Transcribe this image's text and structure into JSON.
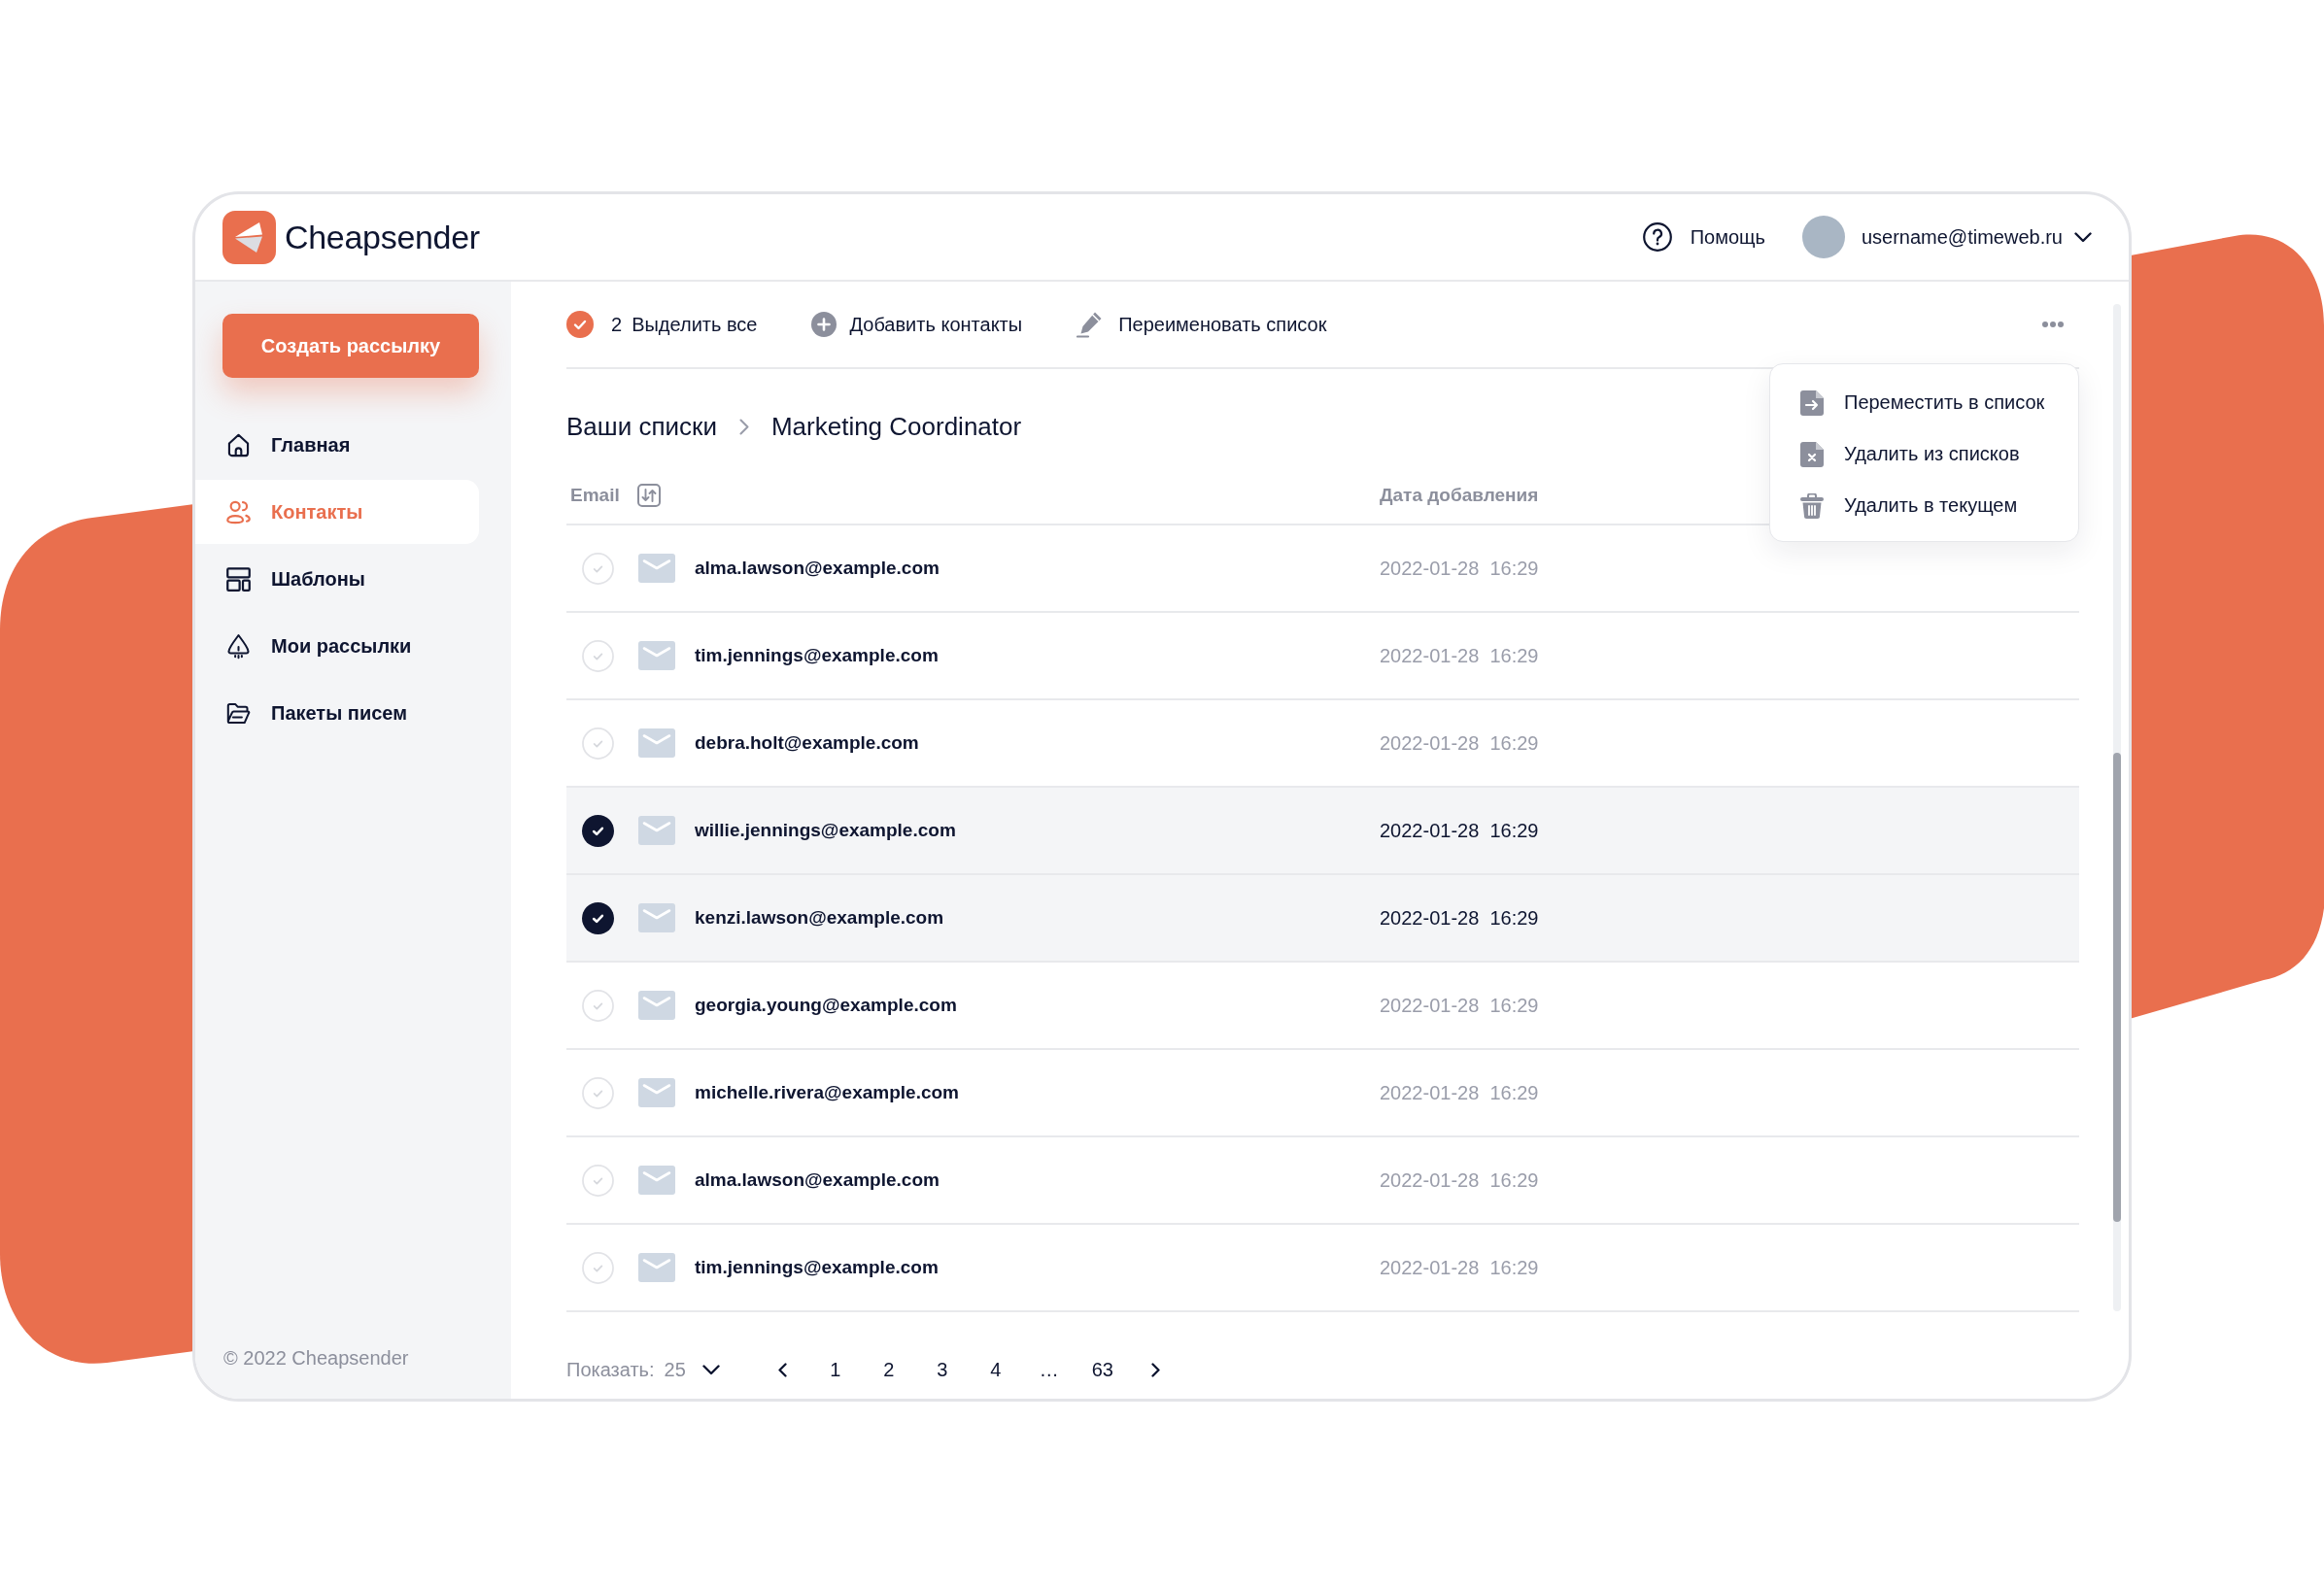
{
  "header": {
    "logo": "Cheapsender",
    "help": "Помощь",
    "user_email": "username@timeweb.ru"
  },
  "sidebar": {
    "create_button": "Создать рассылку",
    "items": [
      {
        "label": "Главная",
        "selected": false
      },
      {
        "label": "Контакты",
        "selected": true
      },
      {
        "label": "Шаблоны",
        "selected": false
      },
      {
        "label": "Мои рассылки",
        "selected": false
      },
      {
        "label": "Пакеты писем",
        "selected": false
      }
    ],
    "footer": "© 2022 Cheapsender"
  },
  "toolbar": {
    "selected_count": "2",
    "select_all": "Выделить все",
    "add_contacts": "Добавить контакты",
    "rename_list": "Переименовать список"
  },
  "menu": {
    "items": [
      "Переместить в список",
      "Удалить из списков",
      "Удалить в текущем"
    ]
  },
  "breadcrumb": [
    "Ваши списки",
    "Marketing Coordinator"
  ],
  "table": {
    "columns": [
      "Email",
      "Дата добавления"
    ],
    "rows": [
      {
        "email": "alma.lawson@example.com",
        "added": "2022-01-28  16:29",
        "selected": false
      },
      {
        "email": "tim.jennings@example.com",
        "added": "2022-01-28  16:29",
        "selected": false
      },
      {
        "email": "debra.holt@example.com",
        "added": "2022-01-28  16:29",
        "selected": false
      },
      {
        "email": "willie.jennings@example.com",
        "added": "2022-01-28  16:29",
        "selected": true
      },
      {
        "email": "kenzi.lawson@example.com",
        "added": "2022-01-28  16:29",
        "selected": true
      },
      {
        "email": "georgia.young@example.com",
        "added": "2022-01-28  16:29",
        "selected": false
      },
      {
        "email": "michelle.rivera@example.com",
        "added": "2022-01-28  16:29",
        "selected": false
      },
      {
        "email": "alma.lawson@example.com",
        "added": "2022-01-28  16:29",
        "selected": false
      },
      {
        "email": "tim.jennings@example.com",
        "added": "2022-01-28  16:29",
        "selected": false
      }
    ]
  },
  "pagination": {
    "label": "Показать:",
    "page_size": "25",
    "pages": [
      "1",
      "2",
      "3",
      "4",
      "…",
      "63"
    ]
  }
}
